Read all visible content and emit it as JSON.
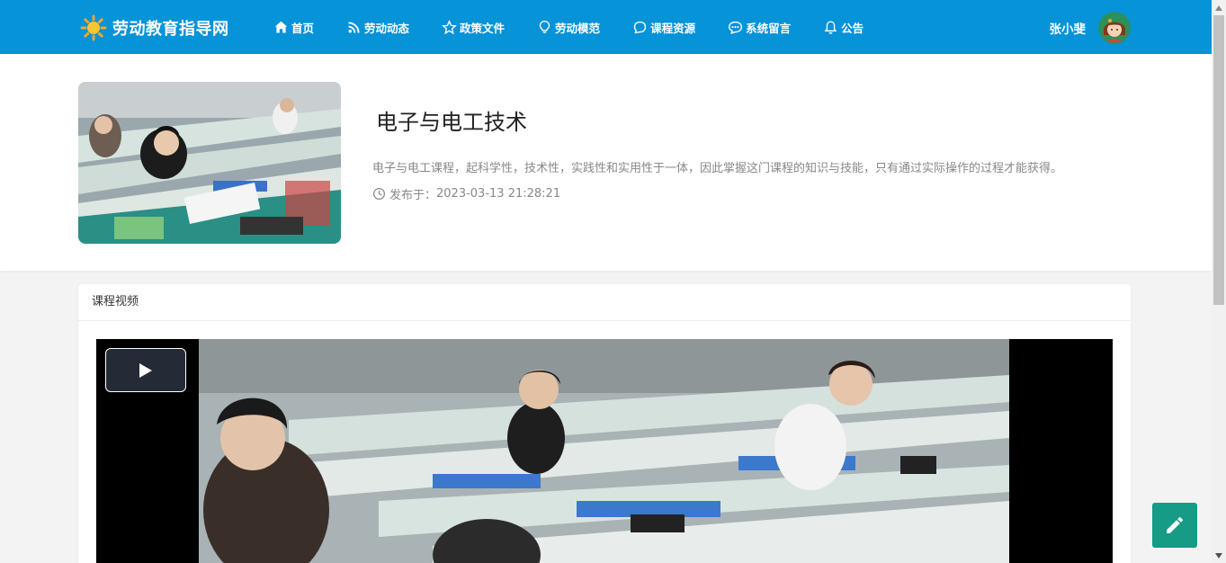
{
  "site": {
    "brand": "劳动教育指导网",
    "nav": [
      {
        "label": "首页",
        "icon": "home-icon"
      },
      {
        "label": "劳动动态",
        "icon": "rss-icon"
      },
      {
        "label": "政策文件",
        "icon": "star-icon"
      },
      {
        "label": "劳动模范",
        "icon": "lightbulb-icon"
      },
      {
        "label": "课程资源",
        "icon": "chat-bubble-icon"
      },
      {
        "label": "系统留言",
        "icon": "message-dots-icon"
      },
      {
        "label": "公告",
        "icon": "bell-icon"
      }
    ],
    "user": {
      "name": "张小斐"
    }
  },
  "course": {
    "title": "电子与电工技术",
    "description": "电子与电工课程，起科学性，技术性，实践性和实用性于一体，因此掌握这门课程的知识与技能，只有通过实际操作的过程才能获得。",
    "published_label": "发布于：",
    "published_at": "2023-03-13 21:28:21"
  },
  "video_section": {
    "title": "课程视频"
  },
  "colors": {
    "navbar": "#0693d8",
    "fab": "#159b86"
  }
}
